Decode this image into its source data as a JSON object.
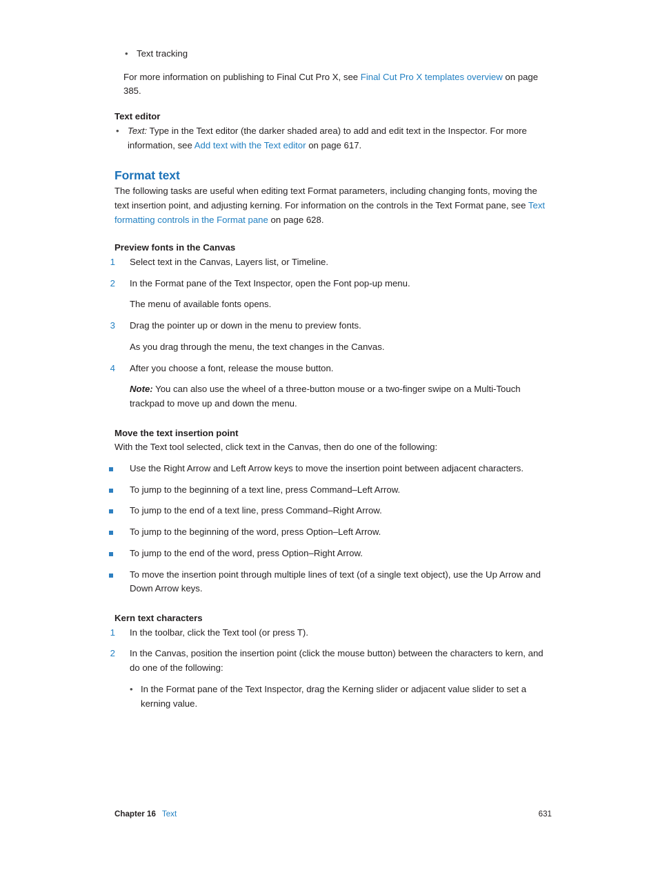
{
  "doc": {
    "bullet_top": {
      "text": "Text tracking"
    },
    "intro_para": {
      "before": "For more information on publishing to Final Cut Pro X, see ",
      "link": "Final Cut Pro X templates overview",
      "after": " on page 385."
    },
    "text_editor": {
      "heading": "Text editor",
      "item_label": "Text:",
      "item_before": " Type in the Text editor (the darker shaded area) to add and edit text in the Inspector. For more information, see ",
      "item_link": "Add text with the Text editor",
      "item_after": " on page 617."
    },
    "format_text": {
      "heading": "Format text",
      "para_before": "The following tasks are useful when editing text Format parameters, including changing fonts, moving the text insertion point, and adjusting kerning. For information on the controls in the Text Format pane, see ",
      "para_link": "Text formatting controls in the Format pane",
      "para_after": " on page 628."
    },
    "preview_fonts": {
      "heading": "Preview fonts in the Canvas",
      "steps": [
        {
          "num": "1",
          "text": "Select text in the Canvas, Layers list, or Timeline."
        },
        {
          "num": "2",
          "text": "In the Format pane of the Text Inspector, open the Font pop-up menu."
        },
        {
          "num": "3",
          "text": "Drag the pointer up or down in the menu to preview fonts."
        },
        {
          "num": "4",
          "text": "After you choose a font, release the mouse button."
        }
      ],
      "result_2": "The menu of available fonts opens.",
      "result_3": "As you drag through the menu, the text changes in the Canvas.",
      "note_label": "Note:",
      "note_text": " You can also use the wheel of a three-button mouse or a two-finger swipe on a Multi-Touch trackpad to move up and down the menu."
    },
    "move_insertion": {
      "heading": "Move the text insertion point",
      "intro": "With the Text tool selected, click text in the Canvas, then do one of the following:",
      "bullets": [
        "Use the Right Arrow and Left Arrow keys to move the insertion point between adjacent characters.",
        "To jump to the beginning of a text line, press Command–Left Arrow.",
        "To jump to the end of a text line, press Command–Right Arrow.",
        "To jump to the beginning of the word, press Option–Left Arrow.",
        "To jump to the end of the word, press Option–Right Arrow.",
        "To move the insertion point through multiple lines of text (of a single text object), use the Up Arrow and Down Arrow keys."
      ]
    },
    "kern": {
      "heading": "Kern text characters",
      "steps": [
        {
          "num": "1",
          "text": "In the toolbar, click the Text tool (or press T)."
        },
        {
          "num": "2",
          "text": "In the Canvas, position the insertion point (click the mouse button) between the characters to kern, and do one of the following:"
        }
      ],
      "sub_bullet": "In the Format pane of the Text Inspector, drag the Kerning slider or adjacent value slider to set a kerning value."
    }
  },
  "footer": {
    "chapter_label": "Chapter 16",
    "chapter_name": "Text",
    "page_number": "631"
  },
  "colors": {
    "link": "#2280c2",
    "section_heading": "#1c72b8",
    "bullet_square": "#2d7fc0",
    "body_text": "#231f20"
  }
}
